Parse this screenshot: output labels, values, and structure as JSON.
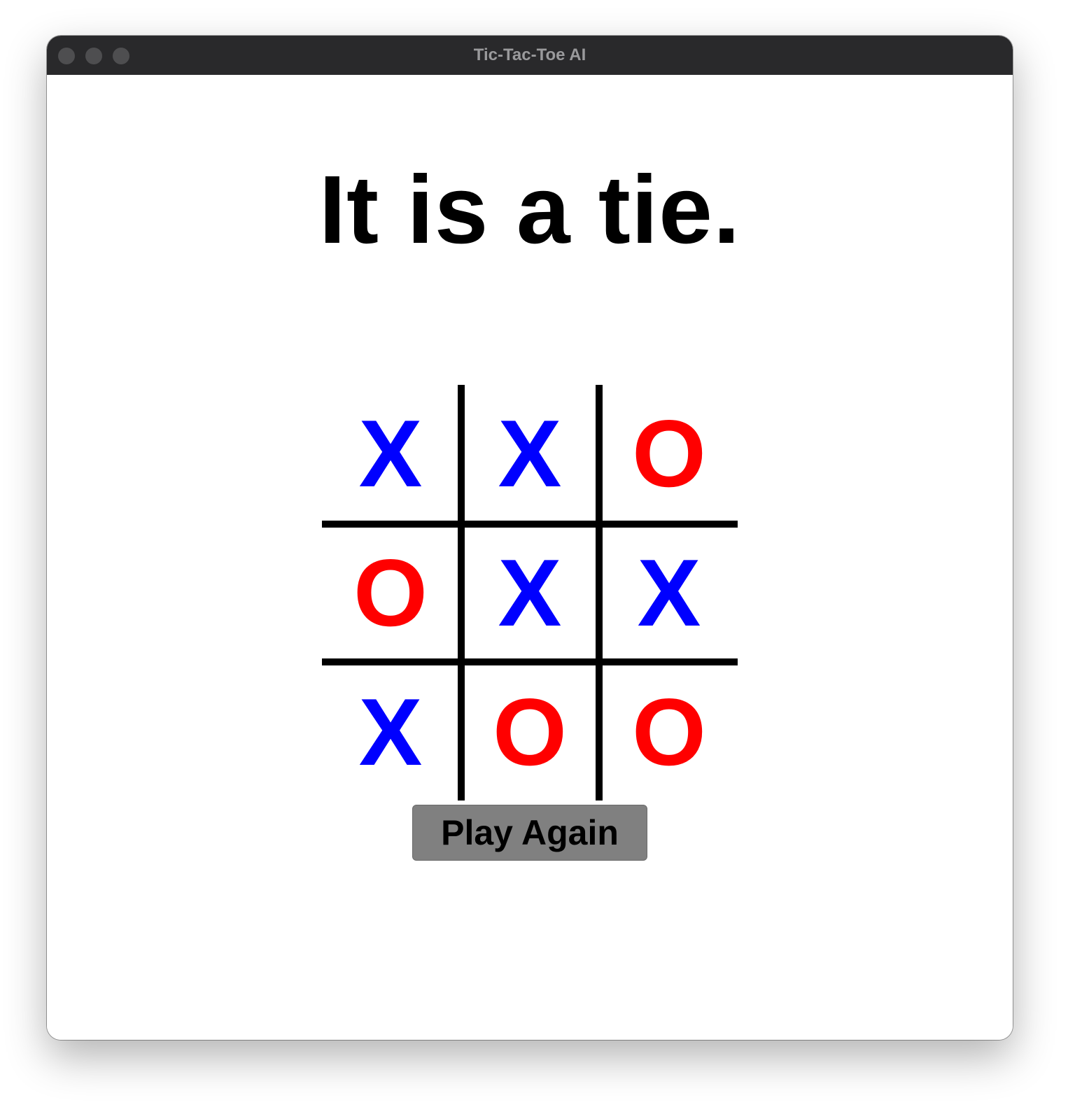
{
  "window": {
    "title": "Tic-Tac-Toe AI",
    "controls": [
      "close",
      "minimize",
      "maximize"
    ]
  },
  "game": {
    "status": "It is a tie.",
    "board": [
      [
        "X",
        "X",
        "O"
      ],
      [
        "O",
        "X",
        "X"
      ],
      [
        "X",
        "O",
        "O"
      ]
    ],
    "x_color": "#0000ff",
    "o_color": "#ff0000",
    "grid_color": "#000000"
  },
  "actions": {
    "play_again_label": "Play Again",
    "button_color": "#808080"
  }
}
